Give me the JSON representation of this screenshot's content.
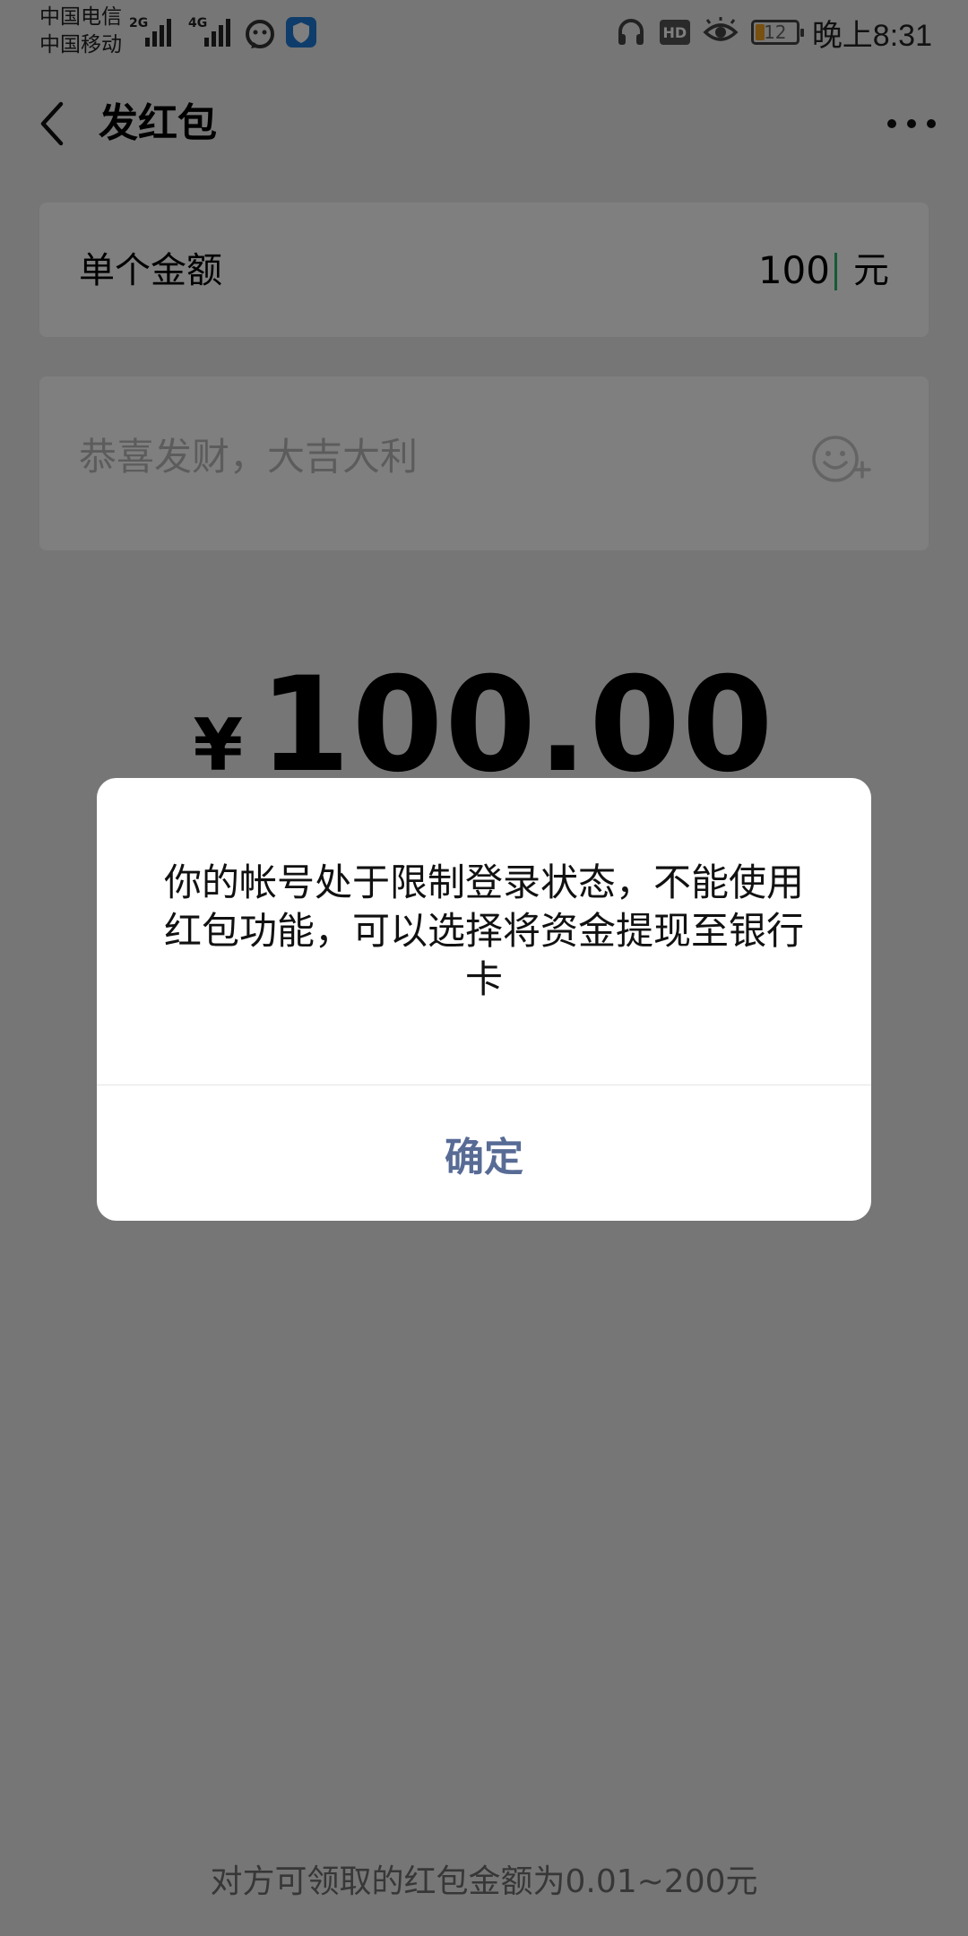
{
  "status_bar": {
    "carrier_1": "中国电信",
    "carrier_2": "中国移动",
    "signal_1_type": "2G",
    "signal_2_type": "4G",
    "hd_label": "HD",
    "battery_level": "12",
    "time": "晚上8:31",
    "icons": [
      "headset-icon",
      "eye-icon",
      "shield-icon",
      "chat-bubble-icon"
    ]
  },
  "header": {
    "title": "发红包",
    "back_icon": "back-chevron-icon",
    "more_icon": "more-dots-icon"
  },
  "amount": {
    "label": "单个金额",
    "value": "100",
    "unit": "元"
  },
  "message": {
    "placeholder": "恭喜发财，大吉大利",
    "emoji_icon": "emoji-add-icon"
  },
  "total": {
    "currency": "¥",
    "value": "100.00"
  },
  "footer": {
    "note": "对方可领取的红包金额为0.01~200元"
  },
  "dialog": {
    "message": "你的帐号处于限制登录状态，不能使用红包功能，可以选择将资金提现至银行卡",
    "confirm_label": "确定"
  },
  "colors": {
    "accent_link": "#576b95",
    "page_bg": "#ededed",
    "overlay": "rgba(0,0,0,0.5)",
    "battery_fill": "#f0a020"
  }
}
